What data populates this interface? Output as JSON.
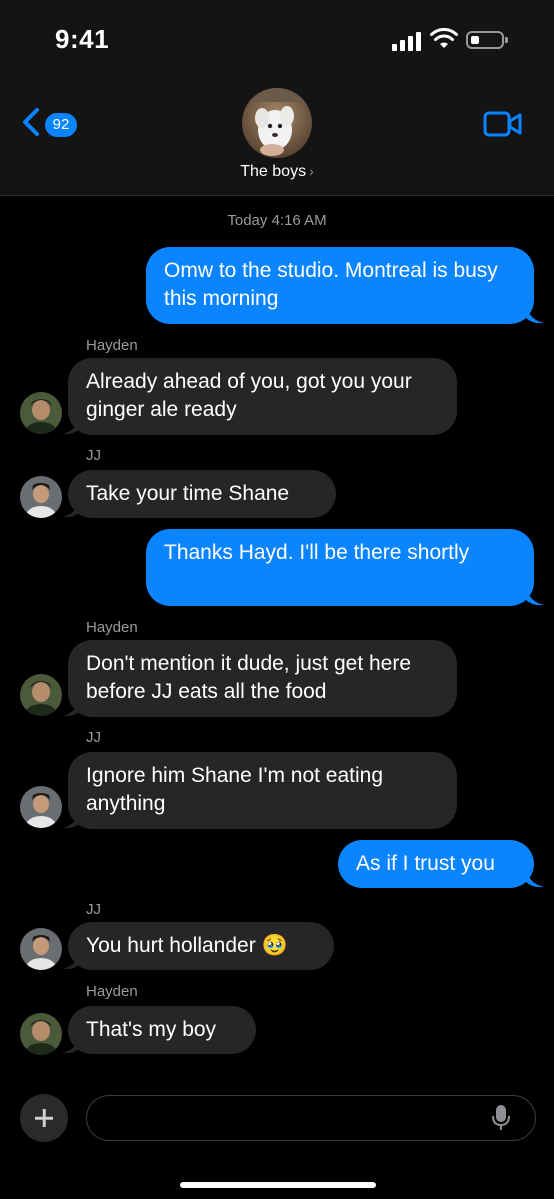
{
  "status_bar": {
    "time": "9:41"
  },
  "nav": {
    "back_count": "92",
    "group_name": "The boys",
    "group_chevron": "›"
  },
  "thread": {
    "timestamp": "Today 4:16 AM",
    "messages": [
      {
        "from": "me",
        "text": "Omw to the studio. Montreal is busy this morning"
      },
      {
        "from": "Hayden",
        "sender_label": "Hayden",
        "text": "Already ahead of you, got you your ginger ale ready"
      },
      {
        "from": "JJ",
        "sender_label": "JJ",
        "text": "Take your time Shane"
      },
      {
        "from": "me",
        "text": "Thanks Hayd. I'll be there shortly"
      },
      {
        "from": "Hayden",
        "sender_label": "Hayden",
        "text": "Don't mention it dude, just get here before JJ eats all the food"
      },
      {
        "from": "JJ",
        "sender_label": "JJ",
        "text": "Ignore him Shane I'm not eating anything"
      },
      {
        "from": "me",
        "text": "As if I trust you"
      },
      {
        "from": "JJ",
        "sender_label": "JJ",
        "text": "You hurt hollander 🥹"
      },
      {
        "from": "Hayden",
        "sender_label": "Hayden",
        "text": "That's my boy"
      }
    ]
  },
  "composer": {
    "placeholder": ""
  },
  "icons": [
    "signal-icon",
    "wifi-icon",
    "battery-icon",
    "back-chevron-icon",
    "video-camera-icon",
    "plus-icon",
    "microphone-icon"
  ],
  "colors": {
    "accent": "#0a84ff",
    "incoming_bubble": "#262629",
    "background": "#000000",
    "header": "#141414"
  }
}
